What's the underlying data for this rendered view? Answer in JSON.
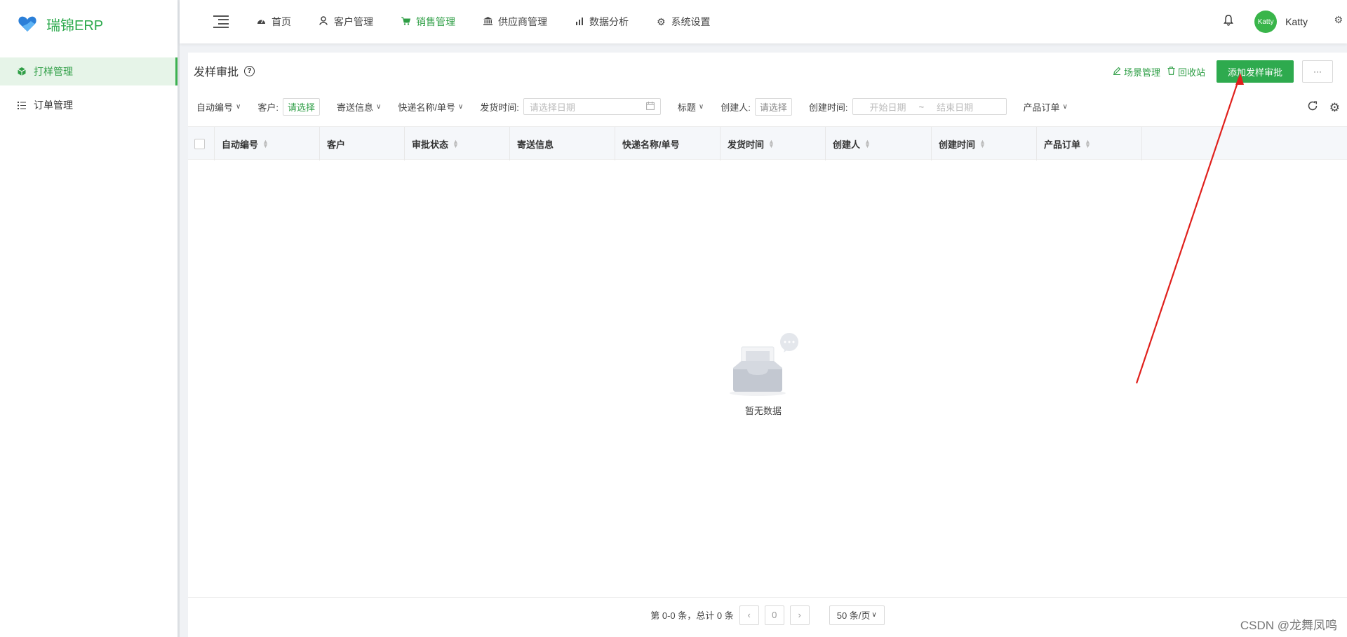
{
  "app": {
    "logo_text": "瑞锦ERP"
  },
  "sidebar": {
    "items": [
      {
        "label": "打样管理",
        "icon": "cube-icon",
        "active": true
      },
      {
        "label": "订单管理",
        "icon": "list-icon",
        "active": false
      }
    ]
  },
  "topnav": {
    "items": [
      {
        "label": "首页",
        "icon": "dashboard-icon"
      },
      {
        "label": "客户管理",
        "icon": "user-icon"
      },
      {
        "label": "销售管理",
        "icon": "cart-icon",
        "active": true
      },
      {
        "label": "供应商管理",
        "icon": "bank-icon"
      },
      {
        "label": "数据分析",
        "icon": "chart-icon"
      },
      {
        "label": "系统设置",
        "icon": "gear-icon"
      }
    ]
  },
  "user": {
    "avatar_text": "Katty",
    "name": "Katty"
  },
  "page": {
    "title": "发样审批",
    "scene_label": "场景管理",
    "recycle_label": "回收站",
    "add_label": "添加发样审批",
    "more_label": "···"
  },
  "filters": {
    "auto_no": "自动编号",
    "customer_label": "客户:",
    "customer_value": "请选择",
    "shipping_info": "寄送信息",
    "courier": "快递名称/单号",
    "ship_time_label": "发货时间:",
    "ship_time_placeholder": "请选择日期",
    "title": "标题",
    "creator_label": "创建人:",
    "creator_value": "请选择",
    "created_time_label": "创建时间:",
    "start_placeholder": "开始日期",
    "range_sep": "~",
    "end_placeholder": "结束日期",
    "product_order": "产品订单"
  },
  "table": {
    "columns": [
      "自动编号",
      "客户",
      "审批状态",
      "寄送信息",
      "快递名称/单号",
      "发货时间",
      "创建人",
      "创建时间",
      "产品订单"
    ],
    "empty_text": "暂无数据"
  },
  "pagination": {
    "summary": "第 0-0 条，总计 0 条",
    "page": "0",
    "page_size": "50 条/页"
  },
  "watermark": "CSDN @龙舞凤鸣",
  "colors": {
    "accent": "#2eaa4e",
    "annotation_arrow": "#e0201c"
  }
}
